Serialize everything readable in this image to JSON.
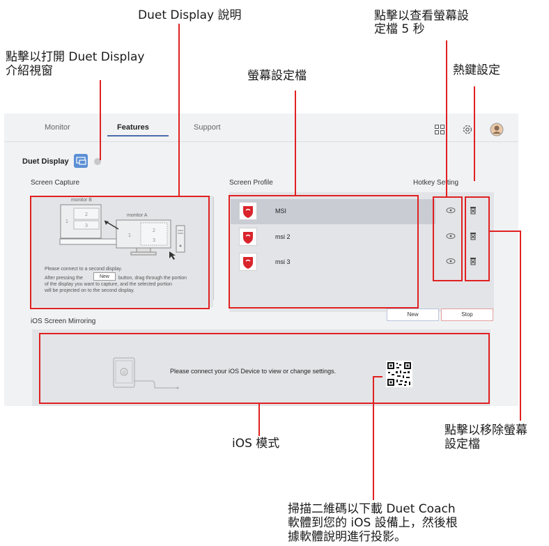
{
  "callouts": {
    "duet_help": "Duet Display 說明",
    "duet_intro_1": "點擊以打開 Duet Display",
    "duet_intro_2": "介紹視窗",
    "screen_profile": "螢幕設定檔",
    "view_profile_1": "點擊以查看螢幕設",
    "view_profile_2": "定檔 5 秒",
    "hotkey": "熱鍵設定",
    "remove_profile_1": "點擊以移除螢幕",
    "remove_profile_2": "設定檔",
    "ios_mode": "iOS 模式",
    "qr_1": "掃描二維碼以下載 Duet Coach",
    "qr_2": "軟體到您的 iOS 設備上，然後根",
    "qr_3": "據軟體說明進行投影。"
  },
  "tabs": [
    {
      "label": "Monitor",
      "active": false
    },
    {
      "label": "Features",
      "active": true
    },
    {
      "label": "Support",
      "active": false
    }
  ],
  "header_icons": [
    "grid-icon",
    "gear-icon",
    "avatar-icon"
  ],
  "duet": {
    "title": "Duet Display"
  },
  "screen_capture": {
    "label": "Screen Capture",
    "monitor_b": "monitor B",
    "monitor_a": "monitor A",
    "instr_1": "Please connect to a second display.",
    "instr_2a": "After pressing the",
    "instr_btn": "New",
    "instr_2b": "button, drag through the portion",
    "instr_3": "of the display you want to capture, and the selected portion",
    "instr_4": "will be projected on to the second display."
  },
  "screen_profile": {
    "label": "Screen Profile",
    "hotkey_label": "Hotkey Setting",
    "profiles": [
      {
        "name": "MSI",
        "selected": true
      },
      {
        "name": "msi 2",
        "selected": false
      },
      {
        "name": "msi 3",
        "selected": false
      }
    ],
    "new_label": "New",
    "stop_label": "Stop"
  },
  "ios": {
    "label": "iOS Screen Mirroring",
    "message": "Please connect your iOS Device to view or change settings."
  },
  "colors": {
    "accent": "#e02020",
    "brand_red": "#d9242c",
    "tab_underline": "#4a6aa8"
  }
}
